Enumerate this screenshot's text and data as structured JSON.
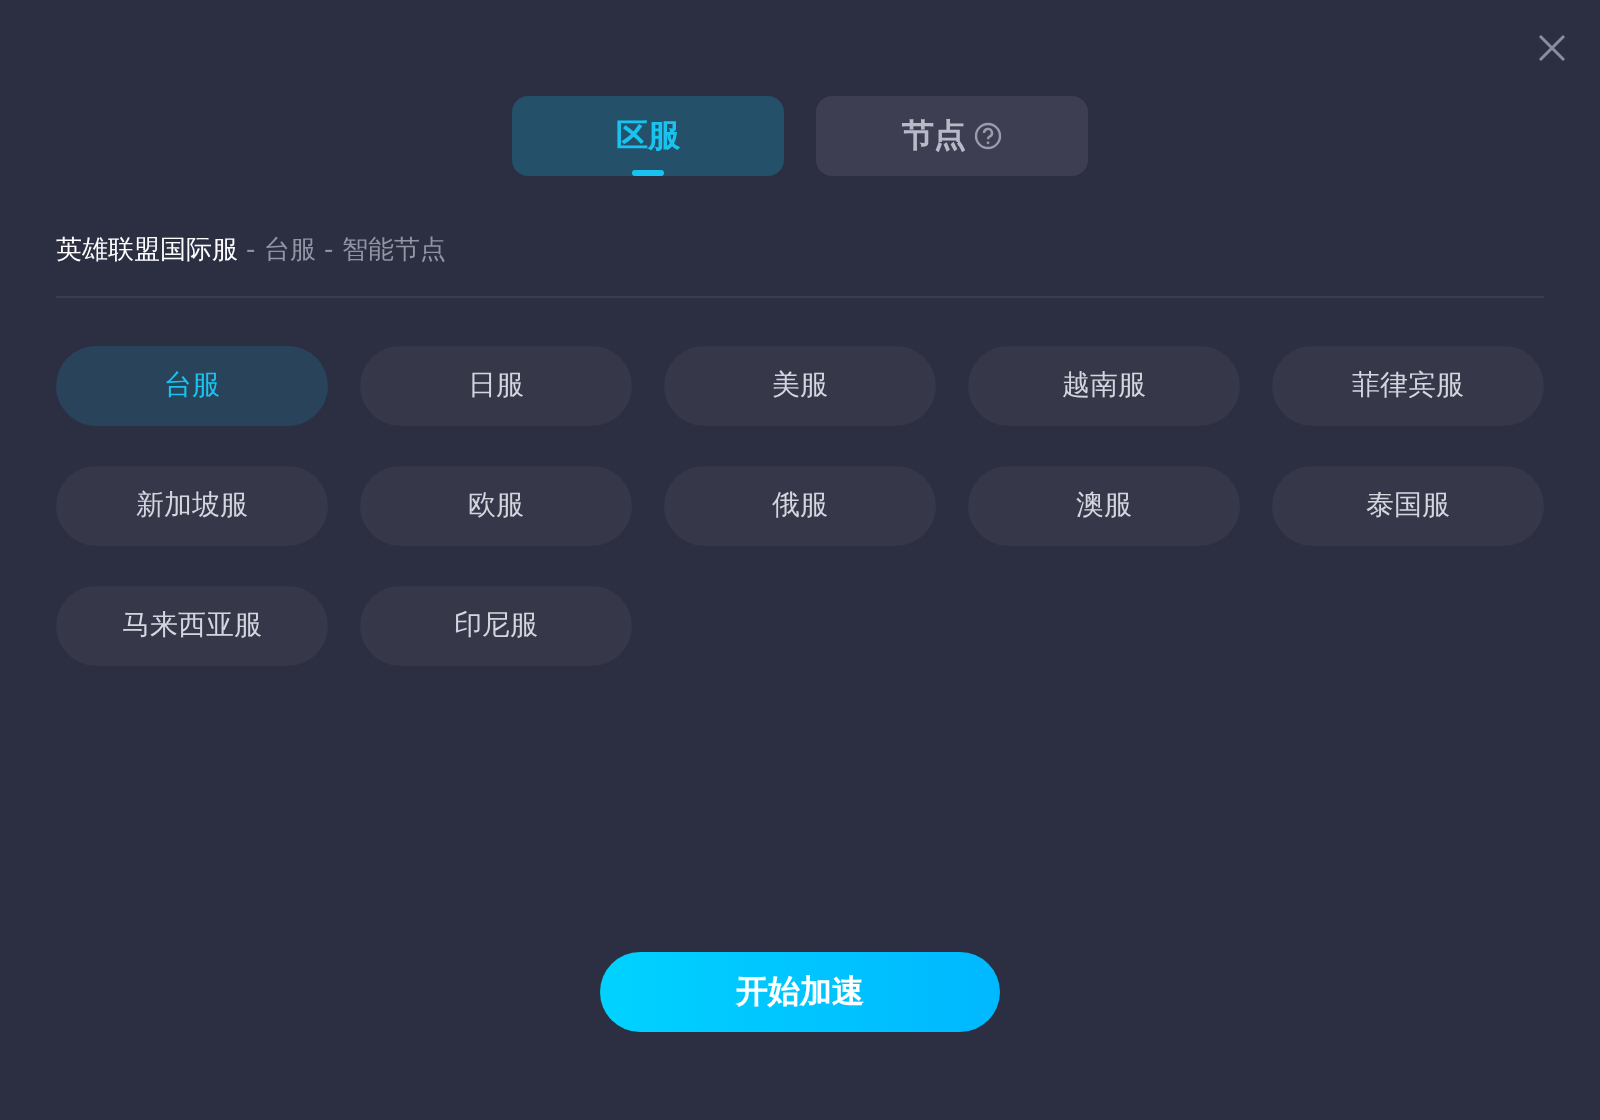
{
  "tabs": [
    {
      "label": "区服",
      "selected": true,
      "help": false
    },
    {
      "label": "节点",
      "selected": false,
      "help": true
    }
  ],
  "breadcrumb": {
    "game": "英雄联盟国际服",
    "path": "- 台服 - 智能节点"
  },
  "servers": [
    {
      "label": "台服",
      "selected": true
    },
    {
      "label": "日服",
      "selected": false
    },
    {
      "label": "美服",
      "selected": false
    },
    {
      "label": "越南服",
      "selected": false
    },
    {
      "label": "菲律宾服",
      "selected": false
    },
    {
      "label": "新加坡服",
      "selected": false
    },
    {
      "label": "欧服",
      "selected": false
    },
    {
      "label": "俄服",
      "selected": false
    },
    {
      "label": "澳服",
      "selected": false
    },
    {
      "label": "泰国服",
      "selected": false
    },
    {
      "label": "马来西亚服",
      "selected": false
    },
    {
      "label": "印尼服",
      "selected": false
    }
  ],
  "start_button": "开始加速"
}
